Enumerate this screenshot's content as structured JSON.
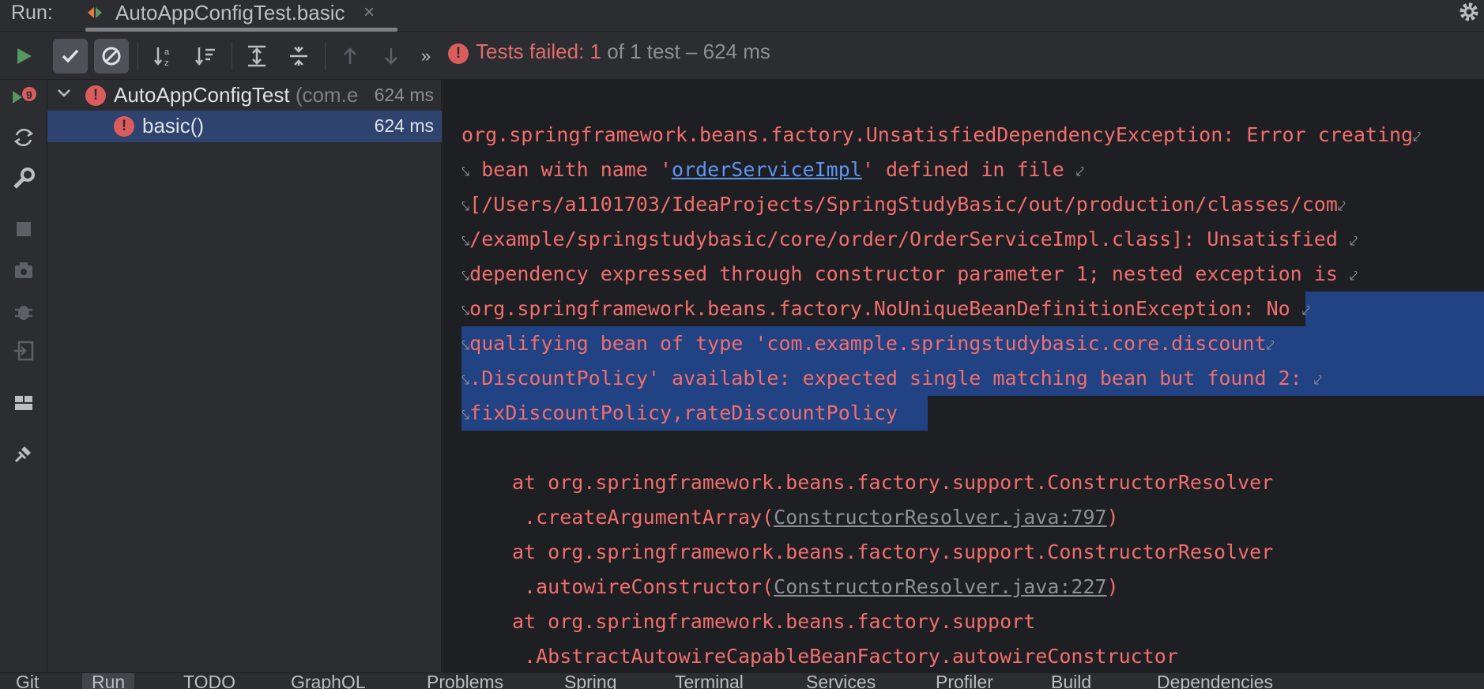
{
  "run_label": "Run:",
  "tab": {
    "title": "AutoAppConfigTest.basic",
    "close": "×"
  },
  "status": {
    "failed_text": "Tests failed: 1",
    "rest_text": " of 1 test – 624 ms",
    "icon_glyph": "!"
  },
  "toolbar": {
    "more": "»"
  },
  "tree": {
    "class_name": "AutoAppConfigTest",
    "class_pkg": " (com.e",
    "class_time": "624 ms",
    "method_name": "basic()",
    "method_time": "624 ms"
  },
  "console": {
    "line1": "org.springframework.beans.factory.UnsatisfiedDependencyException: Error creating",
    "line2a": " bean with name '",
    "line2_link": "orderServiceImpl",
    "line2b": "' defined in file ",
    "line3": "[/Users/a1101703/IdeaProjects/SpringStudyBasic/out/production/classes/com",
    "line4": "/example/springstudybasic/core/order/OrderServiceImpl.class]: Unsatisfied ",
    "line5": "dependency expressed through constructor parameter 1; nested exception is ",
    "line6a": "org.springframework.beans.factory.NoUniqueBeanDefinitionException: ",
    "line6b": "No ",
    "line7": "qualifying bean of type 'com.example.springstudybasic.core.discount",
    "line8": ".DiscountPolicy' available: expected single matching bean but found 2: ",
    "line9": "fixDiscountPolicy,rateDiscountPolicy",
    "st1": "at org.springframework.beans.factory.support.ConstructorResolver",
    "st2a": " .createArgumentArray(",
    "st2_link": "ConstructorResolver.java:797",
    "st2b": ")",
    "st3": "at org.springframework.beans.factory.support.ConstructorResolver",
    "st4a": " .autowireConstructor(",
    "st4_link": "ConstructorResolver.java:227",
    "st4b": ")",
    "st5": "at org.springframework.beans.factory.support",
    "st6": " .AbstractAutowireCapableBeanFactory.autowireConstructor",
    "wrap_end": "⤦",
    "wrap_start": "⤥"
  },
  "bottom_tabs": [
    "Git",
    "Run",
    "TODO",
    "GraphQL",
    "Problems",
    "Spring",
    "Terminal",
    "Services",
    "Profiler",
    "Build",
    "Dependencies"
  ],
  "colors": {
    "error": "#f26e6e",
    "selection": "#214283",
    "console_bg": "#1e1f22",
    "panel_bg": "#2b2d30"
  }
}
